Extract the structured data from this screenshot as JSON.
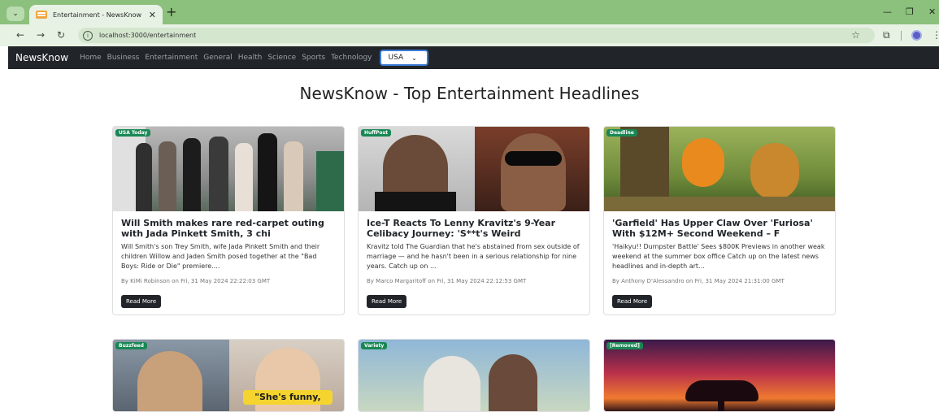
{
  "browser": {
    "tab_title": "Entertainment - NewsKnow",
    "url": "localhost:3000/entertainment"
  },
  "navbar": {
    "brand": "NewsKnow",
    "links": [
      "Home",
      "Business",
      "Entertainment",
      "General",
      "Health",
      "Science",
      "Sports",
      "Technology"
    ],
    "country": "USA"
  },
  "page": {
    "heading": "NewsKnow - Top Entertainment Headlines"
  },
  "articles": [
    {
      "source": "USA Today",
      "title": "Will Smith makes rare red-carpet outing with Jada Pinkett Smith, 3 chi",
      "description": "Will Smith's son Trey Smith, wife Jada Pinkett Smith and their children Willow and Jaden Smith posed together at the \"Bad Boys: Ride or Die\" premiere....",
      "meta": "By KiMi Robinson on Fri, 31 May 2024 22:22:03 GMT",
      "button": "Read More"
    },
    {
      "source": "HuffPost",
      "title": "Ice-T Reacts To Lenny Kravitz's 9-Year Celibacy Journey: 'S**t's Weird",
      "description": "Kravitz told The Guardian that he's abstained from sex outside of marriage — and he hasn't been in a serious relationship for nine years. Catch up on ...",
      "meta": "By Marco Margaritoff on Fri, 31 May 2024 22:12:53 GMT",
      "button": "Read More"
    },
    {
      "source": "Deadline",
      "title": "'Garfield' Has Upper Claw Over 'Furiosa' With $12M+ Second Weekend – F",
      "description": "'Haikyu!! Dumpster Battle' Sees $800K Previews in another weak weekend at the summer box office Catch up on the latest news headlines and in-depth art...",
      "meta": "By Anthony D'Alessandro on Fri, 31 May 2024 21:31:00 GMT",
      "button": "Read More"
    },
    {
      "source": "Buzzfeed",
      "image_caption": "\"She's funny,"
    },
    {
      "source": "Variety"
    },
    {
      "source": "[Removed]"
    }
  ],
  "icons": [
    "tab-menu-icon",
    "favicon-icon",
    "close-icon",
    "plus-icon",
    "minimize-icon",
    "restore-icon",
    "back-icon",
    "forward-icon",
    "reload-icon",
    "site-info-icon",
    "star-icon",
    "extensions-icon",
    "profile-icon",
    "kebab-icon",
    "chevron-down-icon"
  ]
}
